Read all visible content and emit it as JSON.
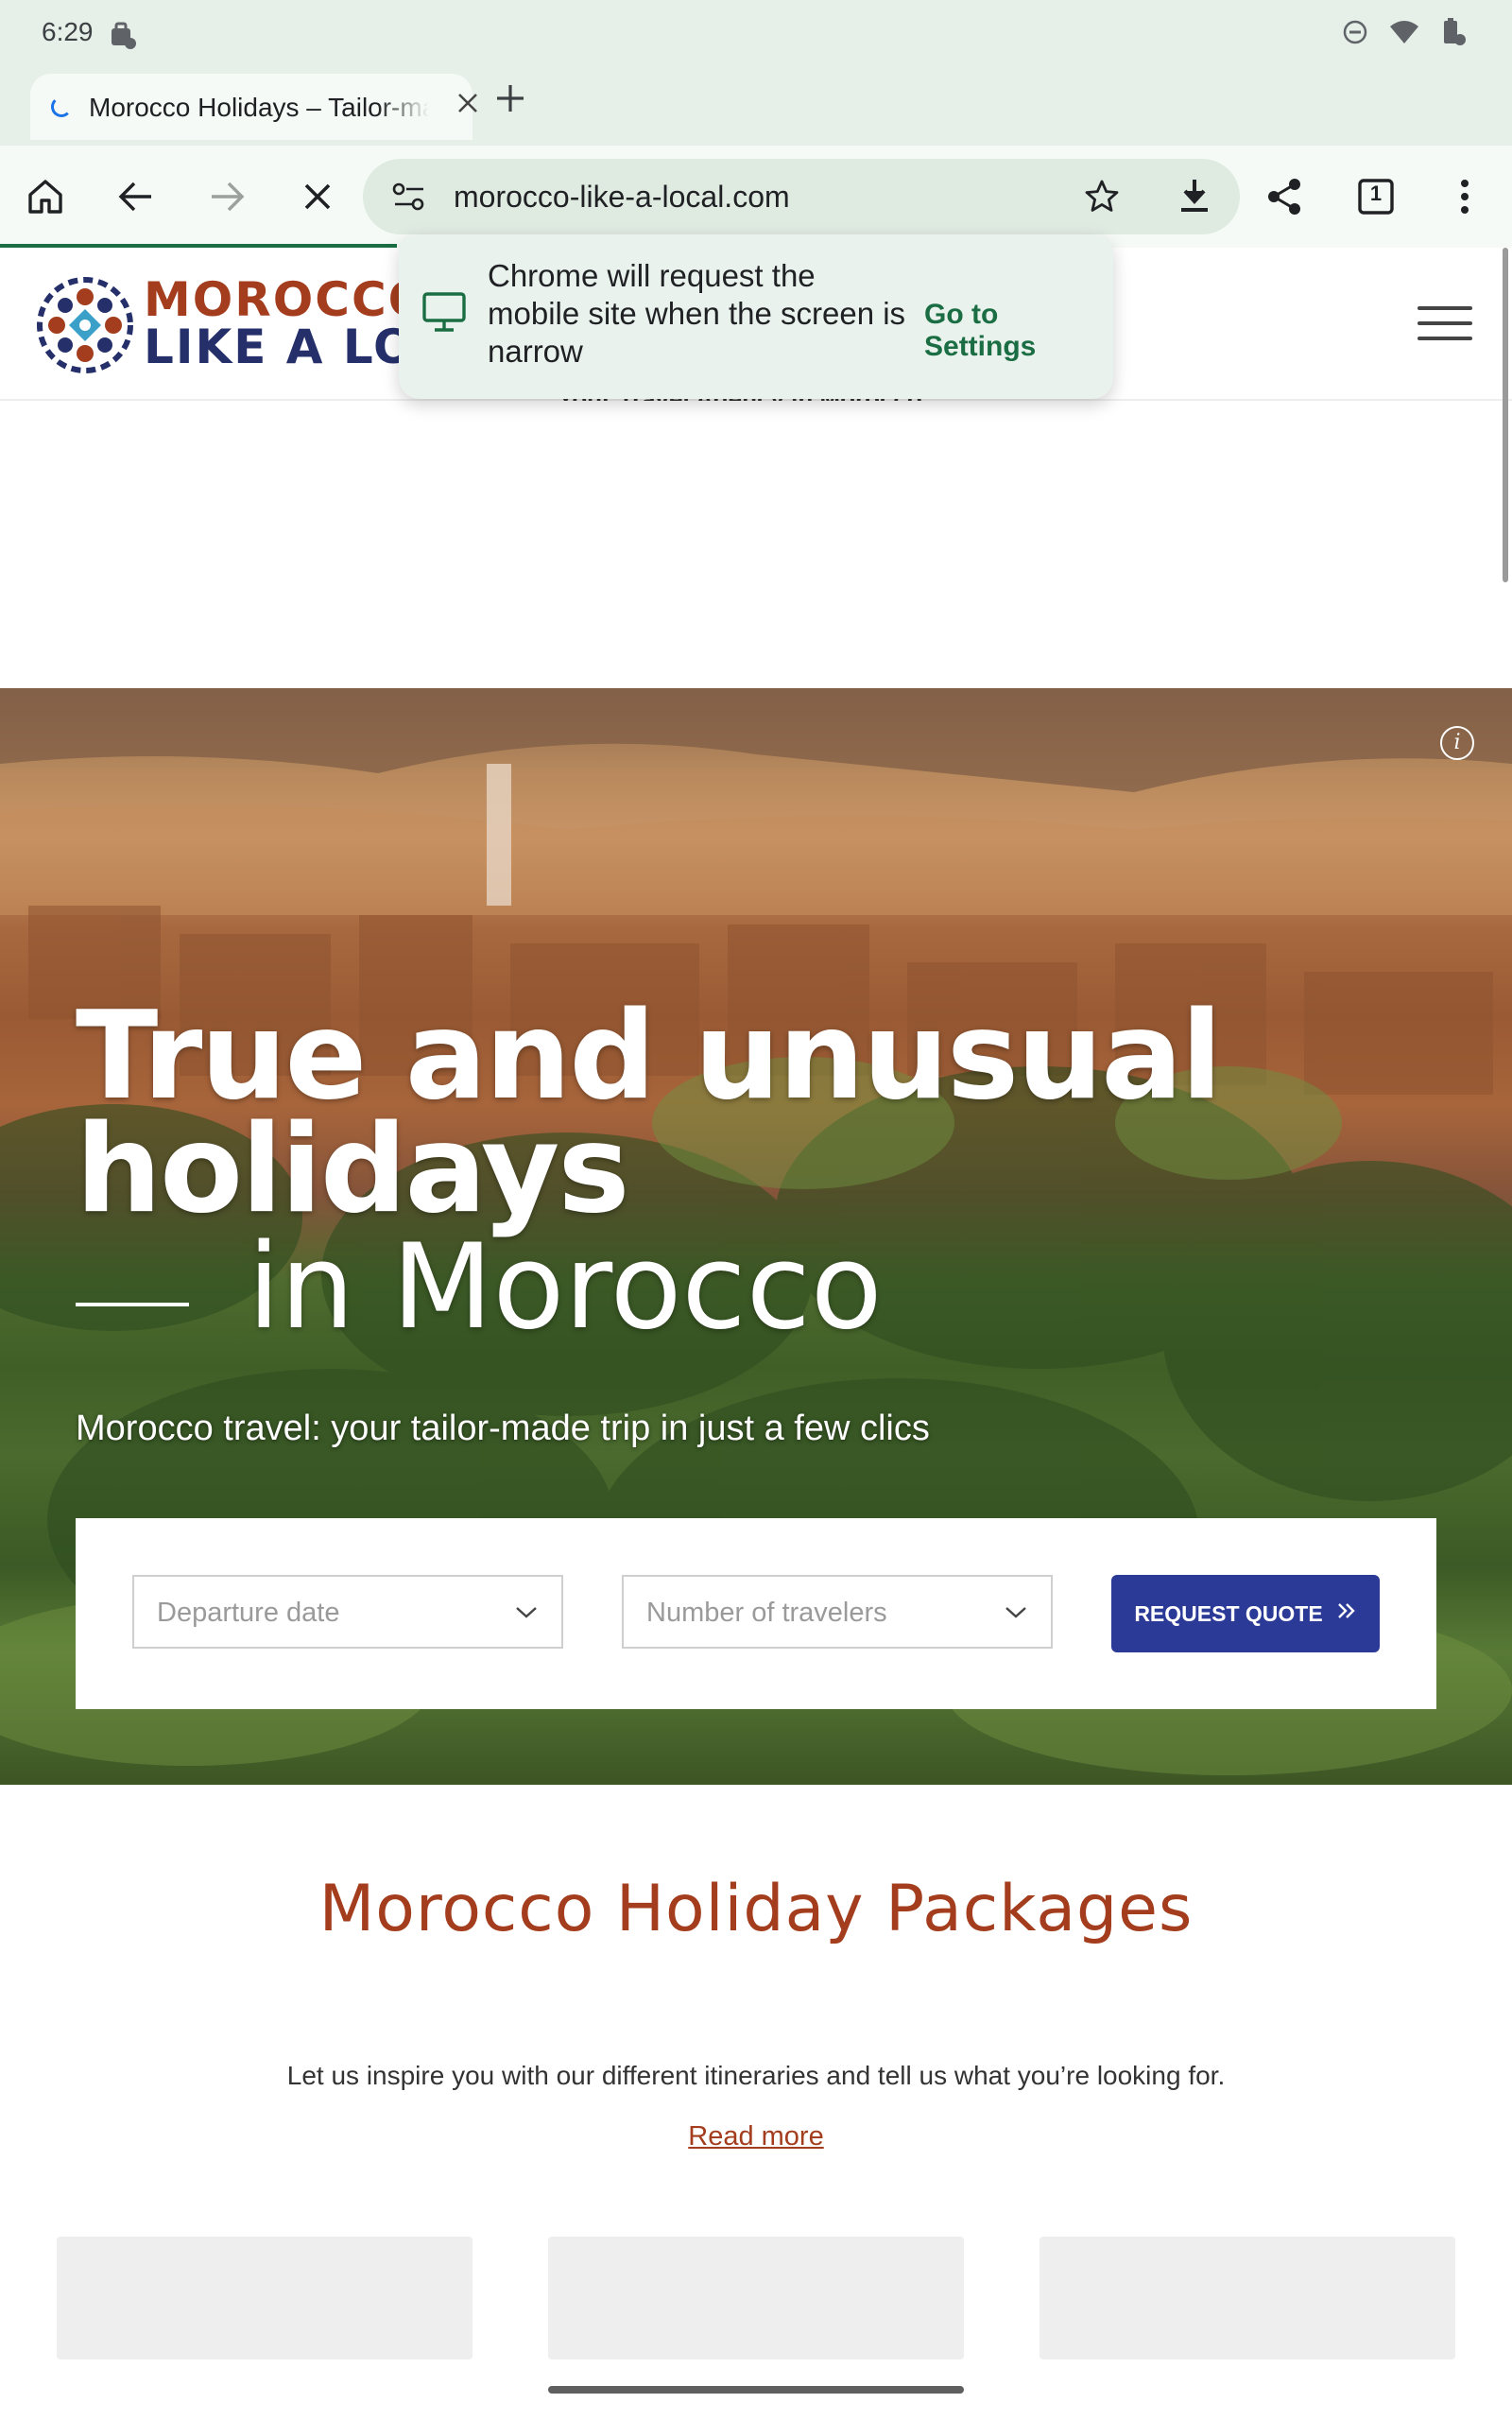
{
  "status_bar": {
    "time": "6:29",
    "left_icon": "work-profile-icon",
    "right_icons": [
      "do-not-disturb-icon",
      "wifi-icon",
      "battery-icon"
    ]
  },
  "tab": {
    "title": "Morocco Holidays – Tailor-made",
    "close_icon": "close-icon",
    "new_tab_icon": "plus-icon"
  },
  "toolbar": {
    "home_icon": "home-icon",
    "back_icon": "back-arrow-icon",
    "forward_icon": "forward-arrow-icon",
    "stop_icon": "close-icon",
    "site_settings_icon": "tune-icon",
    "url": "morocco-like-a-local.com",
    "bookmark_icon": "star-icon",
    "download_icon": "download-icon",
    "share_icon": "share-icon",
    "tab_count": "1",
    "menu_icon": "more-vert-icon"
  },
  "popup": {
    "message": "Chrome will request the mobile site when the screen is narrow",
    "action": "Go to Settings",
    "icon": "desktop-icon"
  },
  "site": {
    "logo_line1": "MOROCCO",
    "logo_line2": "LIKE A LOCAL",
    "tagline": "Your Travel Agency in Morocco",
    "menu_icon": "hamburger-menu-icon"
  },
  "hero": {
    "title_line1": "True and unusual",
    "title_line2": "holidays",
    "title_line3": "in Morocco",
    "subtitle": "Morocco travel: your tailor-made trip in just a few clics",
    "info_icon": "info-icon",
    "departure_placeholder": "Departure date",
    "travelers_placeholder": "Number of travelers",
    "quote_button": "REQUEST QUOTE"
  },
  "packages": {
    "title": "Morocco Holiday Packages",
    "description": "Let us inspire you with our different itineraries and tell us what you’re looking for.",
    "read_more": "Read more"
  },
  "colors": {
    "brand_red": "#a33d1d",
    "brand_blue": "#25306b",
    "button_blue": "#2b3a96",
    "chrome_green": "#1b6e43"
  }
}
